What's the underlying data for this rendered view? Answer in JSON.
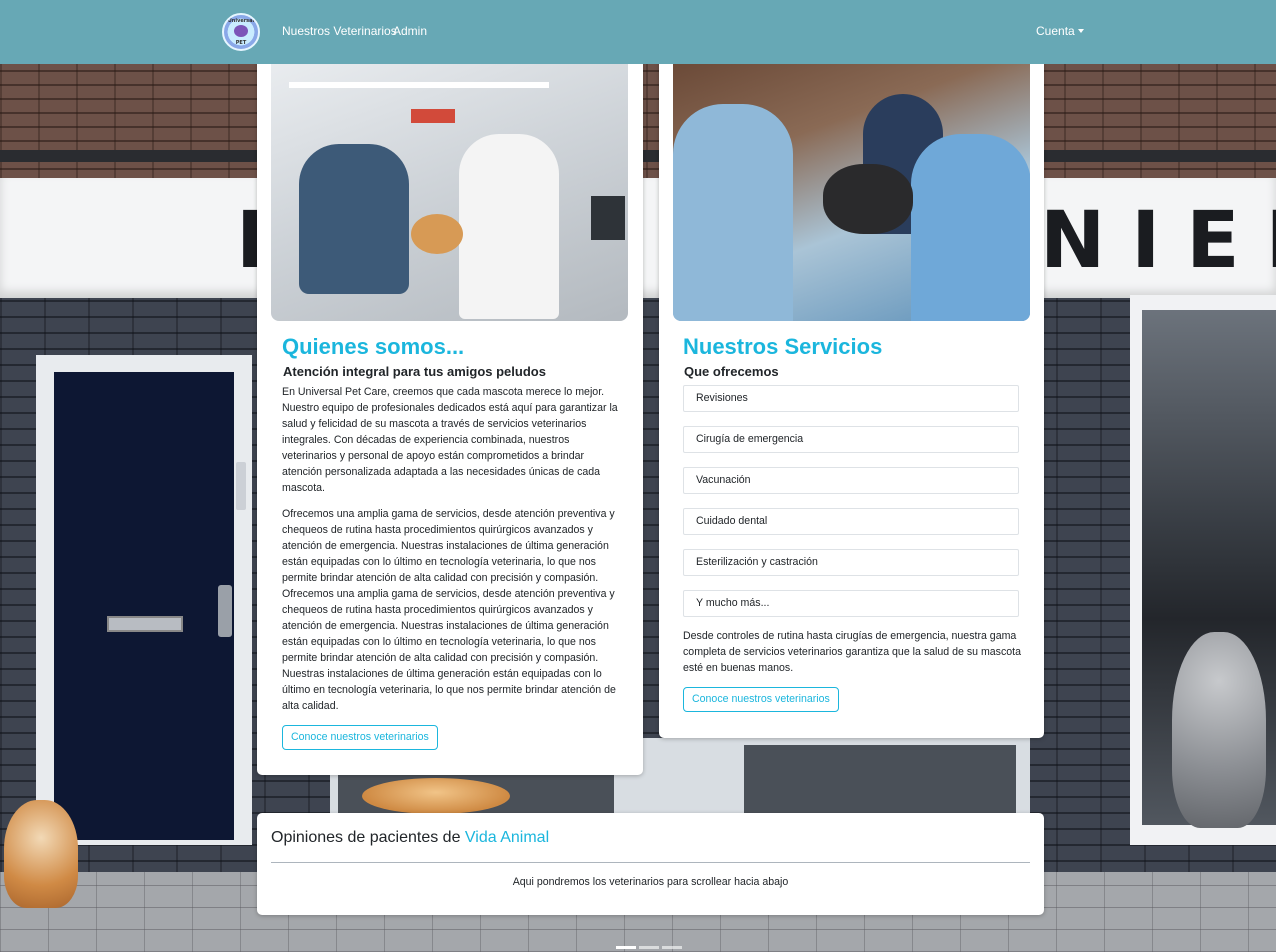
{
  "navbar": {
    "logo_top_text": "Universal",
    "logo_bottom_text": "PET",
    "links": [
      "Nuestros Veterinarios",
      "Admin"
    ],
    "account_label": "Cuenta"
  },
  "background": {
    "sign_text": "D",
    "sign_text_right": "NIEK"
  },
  "about": {
    "title": "Quienes somos...",
    "subtitle": "Atención integral para tus amigos peludos",
    "paragraph_1": "En Universal Pet Care, creemos que cada mascota merece lo mejor. Nuestro equipo de profesionales dedicados está aquí para garantizar la salud y felicidad de su mascota a través de servicios veterinarios integrales. Con décadas de experiencia combinada, nuestros veterinarios y personal de apoyo están comprometidos a brindar atención personalizada adaptada a las necesidades únicas de cada mascota.",
    "paragraph_2": "Ofrecemos una amplia gama de servicios, desde atención preventiva y chequeos de rutina hasta procedimientos quirúrgicos avanzados y atención de emergencia. Nuestras instalaciones de última generación están equipadas con lo último en tecnología veterinaria, lo que nos permite brindar atención de alta calidad con precisión y compasión. Ofrecemos una amplia gama de servicios, desde atención preventiva y chequeos de rutina hasta procedimientos quirúrgicos avanzados y atención de emergencia. Nuestras instalaciones de última generación están equipadas con lo último en tecnología veterinaria, lo que nos permite brindar atención de alta calidad con precisión y compasión. Nuestras instalaciones de última generación están equipadas con lo último en tecnología veterinaria, lo que nos permite brindar atención de alta calidad.",
    "button_label": "Conoce nuestros veterinarios"
  },
  "services": {
    "title": "Nuestros Servicios",
    "subtitle": "Que ofrecemos",
    "items": [
      "Revisiones",
      "Cirugía de emergencia",
      "Vacunación",
      "Cuidado dental",
      "Esterilización y castración",
      "Y mucho más..."
    ],
    "description": "Desde controles de rutina hasta cirugías de emergencia, nuestra gama completa de servicios veterinarios garantiza que la salud de su mascota esté en buenas manos.",
    "button_label": "Conoce nuestros veterinarios"
  },
  "opinions": {
    "title_prefix": "Opiniones de pacientes de ",
    "title_accent": "Vida Animal",
    "body": "Aqui pondremos los veterinarios para scrollear hacia abajo"
  },
  "carousel": {
    "slide_count": 3,
    "active_index": 0
  },
  "colors": {
    "navbar": "#67a8b5",
    "accent": "#1bb6dd"
  }
}
